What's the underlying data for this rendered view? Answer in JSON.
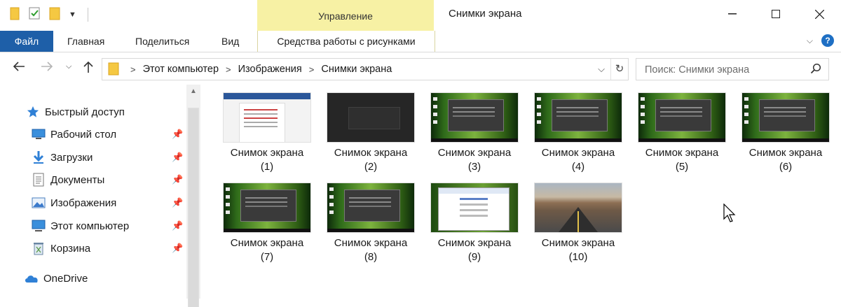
{
  "window": {
    "title": "Снимки экрана",
    "context_tab": "Управление"
  },
  "ribbon": {
    "tabs": [
      "Файл",
      "Главная",
      "Поделиться",
      "Вид"
    ],
    "context_tools": "Средства работы с рисунками"
  },
  "address": {
    "crumbs": [
      "Этот компьютер",
      "Изображения",
      "Снимки экрана"
    ]
  },
  "search": {
    "placeholder": "Поиск: Снимки экрана"
  },
  "nav": {
    "quick_access": "Быстрый доступ",
    "items": [
      "Рабочий стол",
      "Загрузки",
      "Документы",
      "Изображения",
      "Этот компьютер",
      "Корзина"
    ],
    "onedrive": "OneDrive"
  },
  "files": [
    {
      "name": "Снимок экрана",
      "num": "(1)"
    },
    {
      "name": "Снимок экрана",
      "num": "(2)"
    },
    {
      "name": "Снимок экрана",
      "num": "(3)"
    },
    {
      "name": "Снимок экрана",
      "num": "(4)"
    },
    {
      "name": "Снимок экрана",
      "num": "(5)"
    },
    {
      "name": "Снимок экрана",
      "num": "(6)"
    },
    {
      "name": "Снимок экрана",
      "num": "(7)"
    },
    {
      "name": "Снимок экрана",
      "num": "(8)"
    },
    {
      "name": "Снимок экрана",
      "num": "(9)"
    },
    {
      "name": "Снимок экрана",
      "num": "(10)"
    }
  ],
  "colors": {
    "file_tab": "#1e5fa8",
    "context_tab": "#f7f1a4",
    "folder": "#f5c842"
  }
}
